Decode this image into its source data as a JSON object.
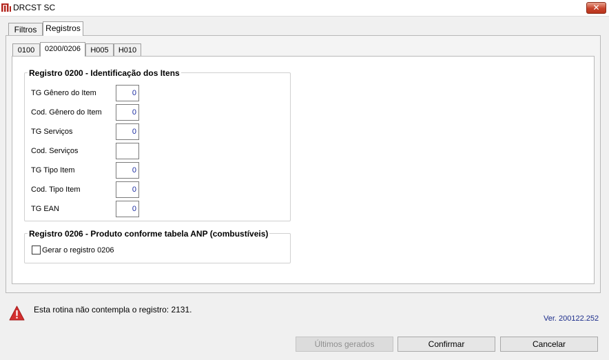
{
  "window": {
    "title": "DRCST SC",
    "close_symbol": "✕"
  },
  "main_tabs": [
    {
      "label": "Filtros",
      "active": false
    },
    {
      "label": "Registros",
      "active": true
    }
  ],
  "sub_tabs": [
    {
      "label": "0100",
      "active": false
    },
    {
      "label": "0200/0206",
      "active": true
    },
    {
      "label": "H005",
      "active": false
    },
    {
      "label": "H010",
      "active": false
    }
  ],
  "group_0200": {
    "title": "Registro 0200 - Identificação dos Itens",
    "fields": [
      {
        "label": "TG Gênero do Item",
        "value": "0"
      },
      {
        "label": "Cod. Gênero do Item",
        "value": "0"
      },
      {
        "label": "TG Serviços",
        "value": "0"
      },
      {
        "label": "Cod. Serviços",
        "value": ""
      },
      {
        "label": "TG Tipo Item",
        "value": "0"
      },
      {
        "label": "Cod. Tipo Item",
        "value": "0"
      },
      {
        "label": "TG EAN",
        "value": "0"
      }
    ]
  },
  "group_0206": {
    "title": "Registro 0206 - Produto conforme tabela ANP (combustíveis)",
    "checkbox_label": "Gerar o registro 0206",
    "checked": false
  },
  "status": {
    "warning": "Esta rotina não contempla o registro: 2131.",
    "version": "Ver. 200122.252"
  },
  "buttons": {
    "ultimos": "Últimos gerados",
    "confirmar": "Confirmar",
    "cancelar": "Cancelar"
  },
  "colors": {
    "value_text": "#1a2ba0",
    "version_text": "#1a2b8a",
    "warning": "#d32f2f"
  }
}
